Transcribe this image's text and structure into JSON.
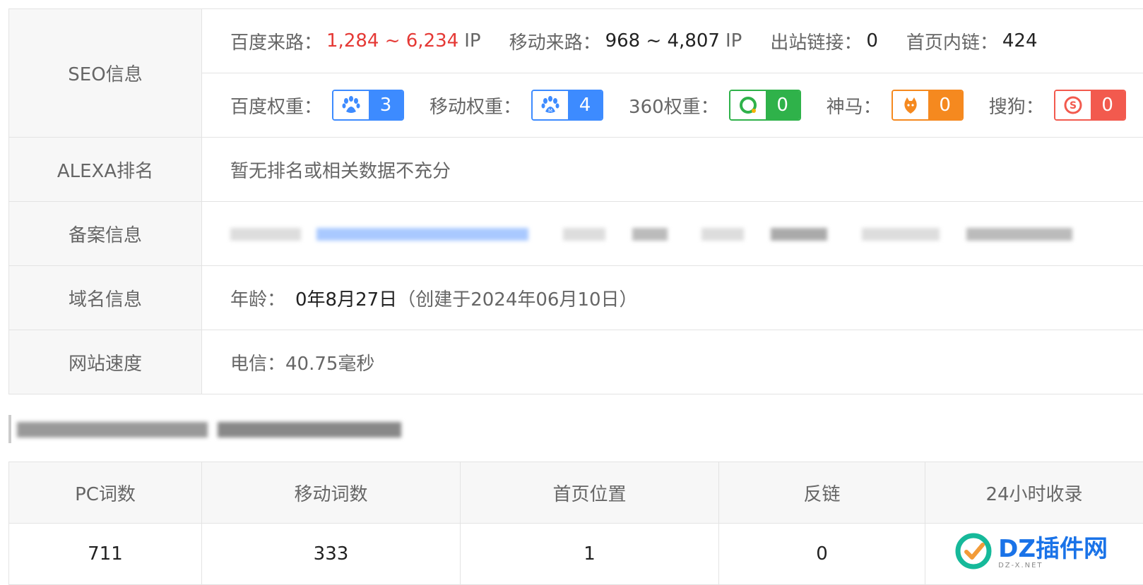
{
  "seo": {
    "label": "SEO信息",
    "baidu_traffic_label": "百度来路：",
    "baidu_traffic_value": "1,284 ~ 6,234",
    "baidu_traffic_unit": "IP",
    "mobile_traffic_label": "移动来路：",
    "mobile_traffic_value": "968 ~ 4,807",
    "mobile_traffic_unit": "IP",
    "outbound_label": "出站链接：",
    "outbound_value": "0",
    "internal_label": "首页内链：",
    "internal_value": "424",
    "weights": [
      {
        "label": "百度权重：",
        "value": "3",
        "color": "#3d8bff",
        "icon": "paw-icon"
      },
      {
        "label": "移动权重：",
        "value": "4",
        "color": "#3d8bff",
        "icon": "paw-mobile-icon"
      },
      {
        "label": "360权重：",
        "value": "0",
        "color": "#2fb24a",
        "icon": "360-icon"
      },
      {
        "label": "神马：",
        "value": "0",
        "color": "#f5891f",
        "icon": "shenma-icon"
      },
      {
        "label": "搜狗：",
        "value": "0",
        "color": "#f25a4e",
        "icon": "sogou-icon"
      }
    ]
  },
  "alexa": {
    "label": "ALEXA排名",
    "value": "暂无排名或相关数据不充分"
  },
  "icp": {
    "label": "备案信息"
  },
  "domain": {
    "label": "域名信息",
    "age_label": "年龄：",
    "age_value": "0年8月27日",
    "created": "（创建于2024年06月10日）"
  },
  "speed": {
    "label": "网站速度",
    "value": "电信：40.75毫秒"
  },
  "stats": {
    "headers": [
      "PC词数",
      "移动词数",
      "首页位置",
      "反链",
      "24小时收录"
    ],
    "values": [
      "711",
      "333",
      "1",
      "0",
      ""
    ]
  },
  "watermark": {
    "main": "DZ插件网",
    "sub": "DZ-X.NET"
  }
}
